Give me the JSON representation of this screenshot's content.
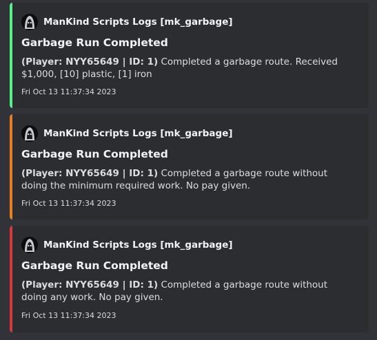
{
  "embeds": [
    {
      "accent_color": "#57f287",
      "author": "ManKind Scripts Logs [mk_garbage]",
      "avatar_icon": "hooded-figure-icon",
      "title": "Garbage Run Completed",
      "player_prefix": "(Player: NYY65649 | ID: 1)",
      "description": "Completed a garbage route. Received $1,000, [10] plastic, [1] iron",
      "timestamp": "Fri Oct 13 11:37:34 2023"
    },
    {
      "accent_color": "#e67e22",
      "author": "ManKind Scripts Logs [mk_garbage]",
      "avatar_icon": "hooded-figure-icon",
      "title": "Garbage Run Completed",
      "player_prefix": "(Player: NYY65649 | ID: 1)",
      "description": "Completed a garbage route without doing the minimum required work. No pay given.",
      "timestamp": "Fri Oct 13 11:37:34 2023"
    },
    {
      "accent_color": "#da373c",
      "author": "ManKind Scripts Logs [mk_garbage]",
      "avatar_icon": "hooded-figure-icon",
      "title": "Garbage Run Completed",
      "player_prefix": "(Player: NYY65649 | ID: 1)",
      "description": "Completed a garbage route without doing any work. No pay given.",
      "timestamp": "Fri Oct 13 11:37:34 2023"
    }
  ]
}
